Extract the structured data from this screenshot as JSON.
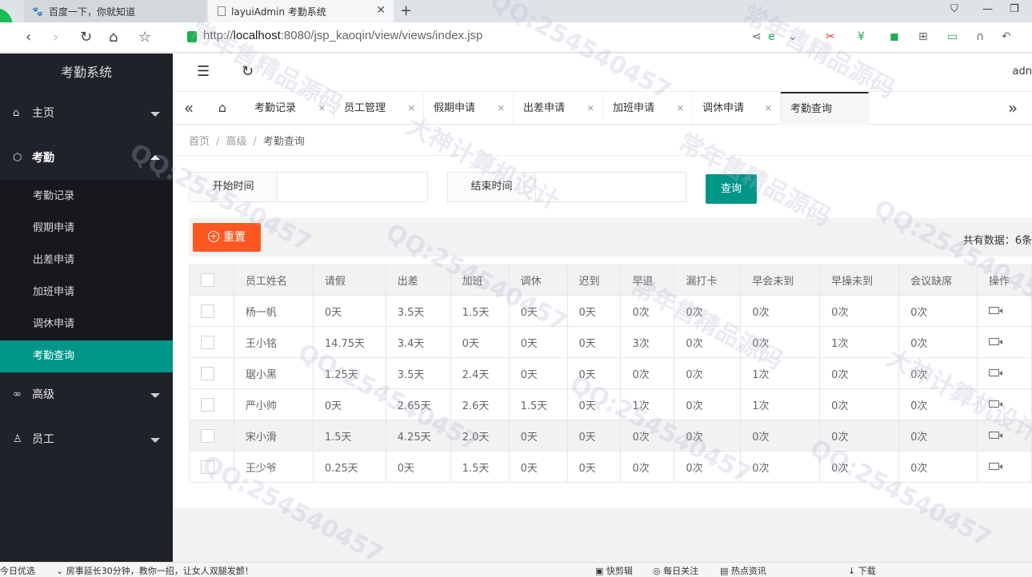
{
  "browser": {
    "tabs": [
      {
        "title": "百度一下，你就知道",
        "active": false
      },
      {
        "title": "layuiAdmin 考勤系统",
        "active": true
      }
    ],
    "url_prefix": "http://",
    "url_host": "localhost",
    "url_rest": ":8080/jsp_kaoqin/view/views/index.jsp"
  },
  "app": {
    "logo": "考勤系统",
    "user": "adn"
  },
  "sidebar": {
    "items": [
      {
        "label": "主页",
        "icon": "home-icon",
        "open": false
      },
      {
        "label": "考勤",
        "icon": "cube-icon",
        "open": true
      },
      {
        "label": "高级",
        "icon": "link-icon",
        "open": false
      },
      {
        "label": "员工",
        "icon": "user-icon",
        "open": false
      }
    ],
    "sub_items": [
      "考勤记录",
      "假期申请",
      "出差申请",
      "加班申请",
      "调休申请",
      "考勤查询"
    ],
    "active_sub": "考勤查询"
  },
  "page_tabs": [
    "考勤记录",
    "员工管理",
    "假期申请",
    "出差申请",
    "加班申请",
    "调休申请",
    "考勤查询"
  ],
  "breadcrumb": [
    "首页",
    "高级",
    "考勤查询"
  ],
  "filters": {
    "start_label": "开始时间",
    "end_label": "结束时间",
    "start_value": "",
    "end_value": "",
    "query_button": "查询"
  },
  "toolbar": {
    "reset_button": "重置",
    "total_text": "共有数据：6条"
  },
  "table": {
    "columns": [
      "员工姓名",
      "请假",
      "出差",
      "加班",
      "调休",
      "迟到",
      "早退",
      "漏打卡",
      "早会未到",
      "早操未到",
      "会议缺席",
      "操作"
    ],
    "rows": [
      [
        "杨一帆",
        "0天",
        "3.5天",
        "1.5天",
        "0天",
        "0天",
        "0次",
        "0次",
        "0次",
        "0次",
        "0次"
      ],
      [
        "王小铭",
        "14.75天",
        "3.4天",
        "0天",
        "0天",
        "0天",
        "3次",
        "0次",
        "0次",
        "1次",
        "0次"
      ],
      [
        "琚小黑",
        "1.25天",
        "3.5天",
        "2.4天",
        "0天",
        "0天",
        "0次",
        "0次",
        "1次",
        "0次",
        "0次"
      ],
      [
        "严小帅",
        "0天",
        "2.65天",
        "2.6天",
        "1.5天",
        "0天",
        "1次",
        "0次",
        "1次",
        "0次",
        "0次"
      ],
      [
        "宋小滑",
        "1.5天",
        "4.25天",
        "2.0天",
        "0天",
        "0天",
        "0次",
        "0次",
        "0次",
        "0次",
        "0次"
      ],
      [
        "王少爷",
        "0.25天",
        "0天",
        "1.5天",
        "0天",
        "0天",
        "0次",
        "0次",
        "0次",
        "0次",
        "0次"
      ]
    ],
    "highlight_row": 4
  },
  "statusbar": {
    "left": "今日优选",
    "news": "房事延长30分钟，教你一招，让女人双腿发颤！",
    "items": [
      "快剪辑",
      "每日关注",
      "热点资讯",
      "下载"
    ]
  },
  "watermarks": [
    "QQ:254540457",
    "常年售精品源码",
    "大神计算机设计"
  ],
  "colors": {
    "sidebar_bg": "#20222a",
    "active_teal": "#009688",
    "reset_orange": "#ff5722"
  }
}
